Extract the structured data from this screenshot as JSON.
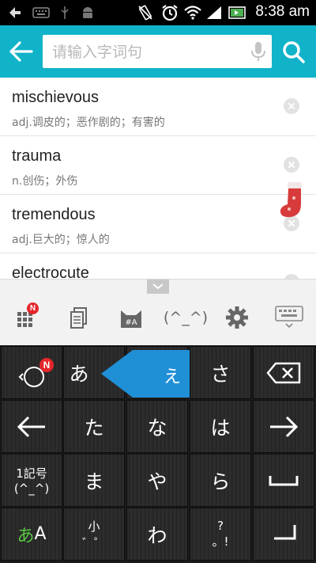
{
  "status_bar": {
    "time": "8:38 am",
    "icons": [
      "back-icon",
      "keyboard-icon",
      "usb-icon",
      "android-icon",
      "no-vibrate-icon",
      "alarm-icon",
      "wifi-icon",
      "signal-icon",
      "battery-icon"
    ]
  },
  "search": {
    "placeholder": "请输入字词句",
    "value": "",
    "icons": {
      "back": "arrow-left-icon",
      "mic": "microphone-icon",
      "search": "search-icon"
    }
  },
  "history": [
    {
      "word": "mischievous",
      "definition": "adj.调皮的；恶作剧的；有害的"
    },
    {
      "word": "trauma",
      "definition": "n.创伤；外伤"
    },
    {
      "word": "tremendous",
      "definition": "adj.巨大的；惊人的"
    },
    {
      "word": "electrocute",
      "definition": ""
    }
  ],
  "keyboard_toolbar": {
    "emoticon": "(^_^)",
    "badge": "N",
    "icons": [
      "grid-icon",
      "clipboard-icon",
      "cat-icon",
      "emoticon-icon",
      "settings-icon",
      "keyboard-icon"
    ]
  },
  "keyboard": {
    "flick_preview": "え",
    "badge": "N",
    "rows": [
      [
        "",
        "あ",
        "",
        "さ",
        ""
      ],
      [
        "",
        "た",
        "な",
        "は",
        ""
      ],
      [
        "",
        "ま",
        "や",
        "ら",
        ""
      ],
      [
        "",
        "",
        "わ",
        "",
        ""
      ]
    ],
    "symbol_key": {
      "top": "1記号",
      "bottom": "(^_^)"
    },
    "lang_key": {
      "kana": "あ",
      "latin": "A"
    },
    "small_key": {
      "label": "小",
      "sub": "゛゜"
    },
    "punct_key": {
      "label": "?",
      "sub": "。!"
    }
  },
  "colors": {
    "header": "#11b3c9",
    "flick": "#1f8fd6",
    "badge": "#e5262a"
  }
}
